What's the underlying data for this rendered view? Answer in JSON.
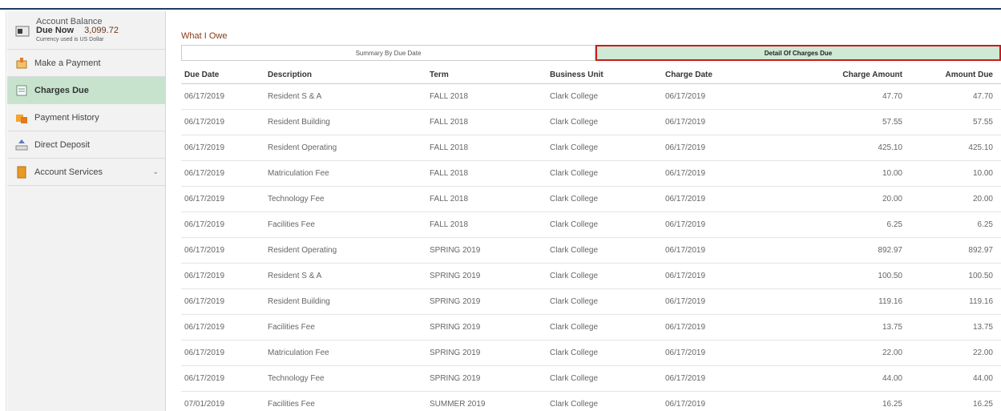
{
  "sidebar": {
    "balance": {
      "label": "Account Balance",
      "due_label": "Due Now",
      "due_value": "3,099.72",
      "currency_note": "Currency used is US Dollar"
    },
    "items": [
      {
        "label": "Make a Payment",
        "icon": "payment-icon"
      },
      {
        "label": "Charges Due",
        "icon": "charges-icon"
      },
      {
        "label": "Payment History",
        "icon": "history-icon"
      },
      {
        "label": "Direct Deposit",
        "icon": "deposit-icon"
      },
      {
        "label": "Account Services",
        "icon": "services-icon"
      }
    ],
    "active_color": "#c7e3cd"
  },
  "main": {
    "title": "What I Owe",
    "tabs": [
      {
        "label": "Summary By Due Date"
      },
      {
        "label": "Detail Of Charges Due"
      }
    ],
    "table": {
      "headers": [
        "Due Date",
        "Description",
        "Term",
        "Business Unit",
        "Charge Date",
        "Charge Amount",
        "Amount Due"
      ],
      "rows": [
        [
          "06/17/2019",
          "Resident S & A",
          "FALL 2018",
          "Clark College",
          "06/17/2019",
          "47.70",
          "47.70"
        ],
        [
          "06/17/2019",
          "Resident Building",
          "FALL 2018",
          "Clark College",
          "06/17/2019",
          "57.55",
          "57.55"
        ],
        [
          "06/17/2019",
          "Resident Operating",
          "FALL 2018",
          "Clark College",
          "06/17/2019",
          "425.10",
          "425.10"
        ],
        [
          "06/17/2019",
          "Matriculation Fee",
          "FALL 2018",
          "Clark College",
          "06/17/2019",
          "10.00",
          "10.00"
        ],
        [
          "06/17/2019",
          "Technology Fee",
          "FALL 2018",
          "Clark College",
          "06/17/2019",
          "20.00",
          "20.00"
        ],
        [
          "06/17/2019",
          "Facilities Fee",
          "FALL 2018",
          "Clark College",
          "06/17/2019",
          "6.25",
          "6.25"
        ],
        [
          "06/17/2019",
          "Resident Operating",
          "SPRING 2019",
          "Clark College",
          "06/17/2019",
          "892.97",
          "892.97"
        ],
        [
          "06/17/2019",
          "Resident S & A",
          "SPRING 2019",
          "Clark College",
          "06/17/2019",
          "100.50",
          "100.50"
        ],
        [
          "06/17/2019",
          "Resident Building",
          "SPRING 2019",
          "Clark College",
          "06/17/2019",
          "119.16",
          "119.16"
        ],
        [
          "06/17/2019",
          "Facilities Fee",
          "SPRING 2019",
          "Clark College",
          "06/17/2019",
          "13.75",
          "13.75"
        ],
        [
          "06/17/2019",
          "Matriculation Fee",
          "SPRING 2019",
          "Clark College",
          "06/17/2019",
          "22.00",
          "22.00"
        ],
        [
          "06/17/2019",
          "Technology Fee",
          "SPRING 2019",
          "Clark College",
          "06/17/2019",
          "44.00",
          "44.00"
        ],
        [
          "07/01/2019",
          "Facilities Fee",
          "SUMMER 2019",
          "Clark College",
          "06/17/2019",
          "16.25",
          "16.25"
        ]
      ]
    }
  }
}
